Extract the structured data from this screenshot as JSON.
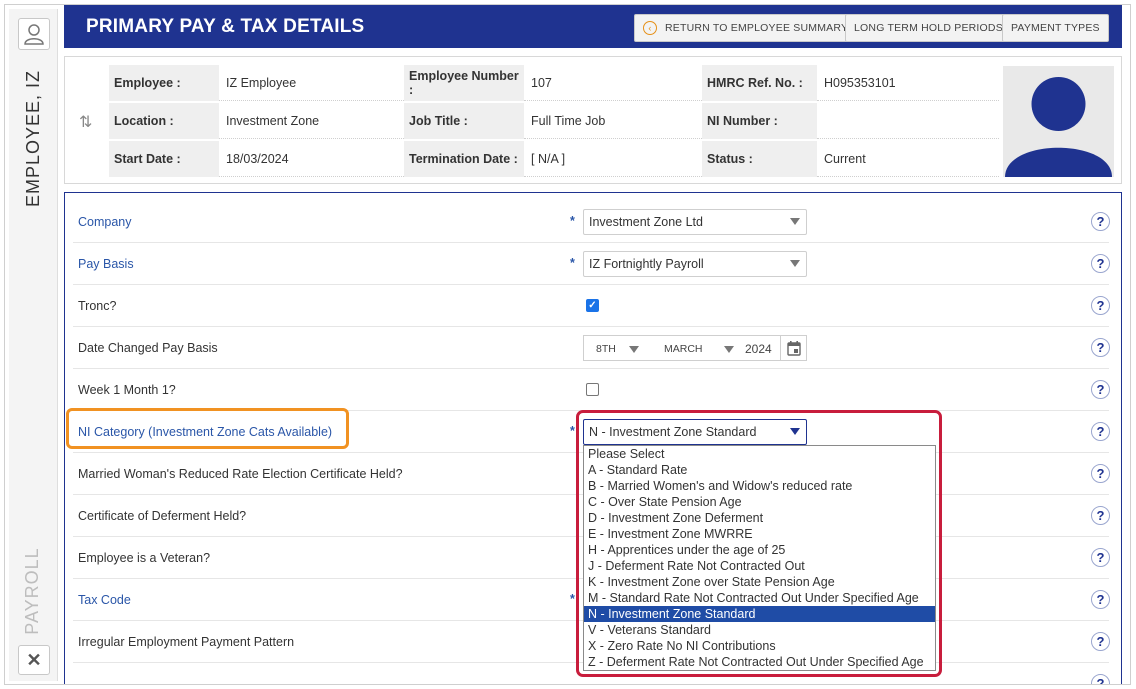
{
  "rail": {
    "employee_name": "EMPLOYEE, IZ",
    "module": "PAYROLL"
  },
  "header": {
    "title": "PRIMARY PAY & TAX DETAILS",
    "buttons": {
      "return": "RETURN TO EMPLOYEE SUMMARY",
      "hold": "LONG TERM HOLD PERIODS",
      "payment": "PAYMENT TYPES"
    }
  },
  "info": {
    "employee_label": "Employee :",
    "employee_value": "IZ Employee",
    "employee_number_label": "Employee Number :",
    "employee_number_value": "107",
    "hmrc_label": "HMRC Ref. No. :",
    "hmrc_value": "H095353101",
    "location_label": "Location :",
    "location_value": "Investment Zone",
    "job_title_label": "Job Title :",
    "job_title_value": "Full Time Job",
    "ni_number_label": "NI Number :",
    "ni_number_value": "",
    "start_date_label": "Start Date :",
    "start_date_value": "18/03/2024",
    "termination_label": "Termination Date :",
    "termination_value": "[ N/A ]",
    "status_label": "Status :",
    "status_value": "Current"
  },
  "form": {
    "company": {
      "label": "Company",
      "value": "Investment Zone Ltd"
    },
    "pay_basis": {
      "label": "Pay Basis",
      "value": "IZ Fortnightly Payroll"
    },
    "tronc": {
      "label": "Tronc?",
      "checked": true
    },
    "date_changed": {
      "label": "Date Changed Pay Basis",
      "day": "8TH",
      "month": "MARCH",
      "year": "2024"
    },
    "week1": {
      "label": "Week 1 Month 1?",
      "checked": false
    },
    "ni_category": {
      "label": "NI Category (Investment Zone Cats Available)",
      "value": "N - Investment Zone Standard"
    },
    "married_woman": {
      "label": "Married Woman's Reduced Rate Election Certificate Held?"
    },
    "deferment": {
      "label": "Certificate of Deferment Held?"
    },
    "veteran": {
      "label": "Employee is a Veteran?"
    },
    "tax_code": {
      "label": "Tax Code"
    },
    "irregular": {
      "label": "Irregular Employment Payment Pattern"
    },
    "help": "?",
    "required": "*"
  },
  "ni_options": [
    "Please Select",
    "A - Standard Rate",
    "B - Married Women's and Widow's reduced rate",
    "C - Over State Pension Age",
    "D - Investment Zone Deferment",
    "E - Investment Zone MWRRE",
    "H - Apprentices under the age of 25",
    "J - Deferment Rate Not Contracted Out",
    "K - Investment Zone over State Pension Age",
    "M - Standard Rate Not Contracted Out Under Specified Age",
    "N - Investment Zone Standard",
    "V - Veterans Standard",
    "X - Zero Rate No NI Contributions",
    "Z - Deferment Rate Not Contracted Out Under Specified Age"
  ],
  "colors": {
    "header": "#1f3390",
    "highlight_orange": "#f19222",
    "highlight_red": "#c81d3c",
    "selected_option": "#1f4ca6"
  }
}
